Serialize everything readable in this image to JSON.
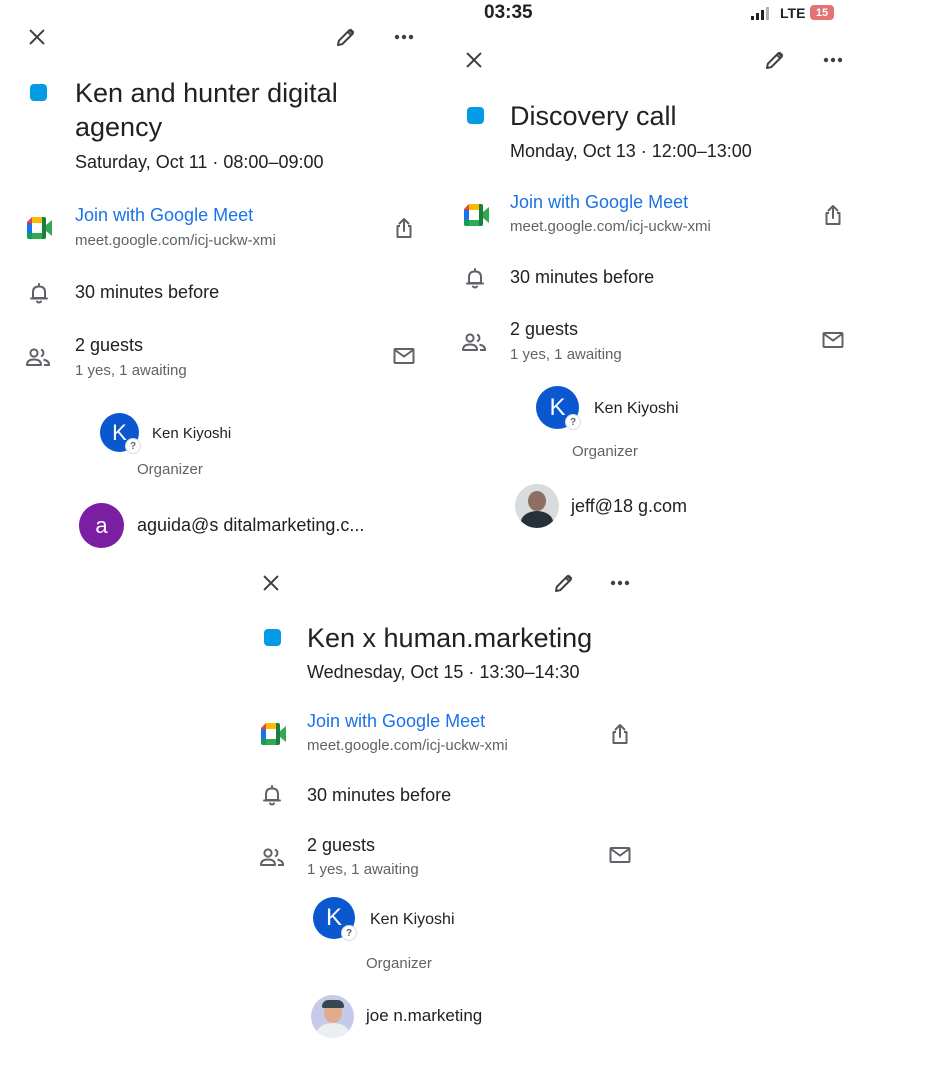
{
  "colors": {
    "event": "#039be5",
    "link": "#1a73e8",
    "avatar_k": "#0b57d0",
    "avatar_a": "#7b1fa2"
  },
  "panel1": {
    "title": "Ken and hunter digital agency",
    "when": "Saturday, Oct 11 · 08:00–09:00",
    "meet_label": "Join with Google Meet",
    "meet_url": "meet.google.com/icj-uckw-xmi",
    "reminder": "30 minutes before",
    "guests": "2 guests",
    "guests_status": "1 yes, 1 awaiting",
    "organizer_name": "Ken Kiyoshi",
    "organizer_initial": "K",
    "organizer_label": "Organizer",
    "guest2_name": "aguida@s ditalmarketing.c...",
    "guest2_initial": "a"
  },
  "panel2": {
    "status_time": "03:35",
    "status_network": "LTE",
    "status_battery": "15",
    "title": "Discovery call",
    "when": "Monday, Oct 13 · 12:00–13:00",
    "meet_label": "Join with Google Meet",
    "meet_url": "meet.google.com/icj-uckw-xmi",
    "reminder": "30 minutes before",
    "guests": "2 guests",
    "guests_status": "1 yes, 1 awaiting",
    "organizer_name": "Ken Kiyoshi",
    "organizer_initial": "K",
    "organizer_label": "Organizer",
    "guest2_name": "jeff@18 g.com"
  },
  "panel3": {
    "title": "Ken x human.marketing",
    "when": "Wednesday, Oct 15 · 13:30–14:30",
    "meet_label": "Join with Google Meet",
    "meet_url": "meet.google.com/icj-uckw-xmi",
    "reminder": "30 minutes before",
    "guests": "2 guests",
    "guests_status": "1 yes, 1 awaiting",
    "organizer_name": "Ken Kiyoshi",
    "organizer_initial": "K",
    "organizer_label": "Organizer",
    "guest2_name": "joe n.marketing"
  },
  "icons": [
    "close-icon",
    "edit-icon",
    "more-icon",
    "google-meet-icon",
    "share-icon",
    "bell-icon",
    "people-icon",
    "mail-icon"
  ]
}
